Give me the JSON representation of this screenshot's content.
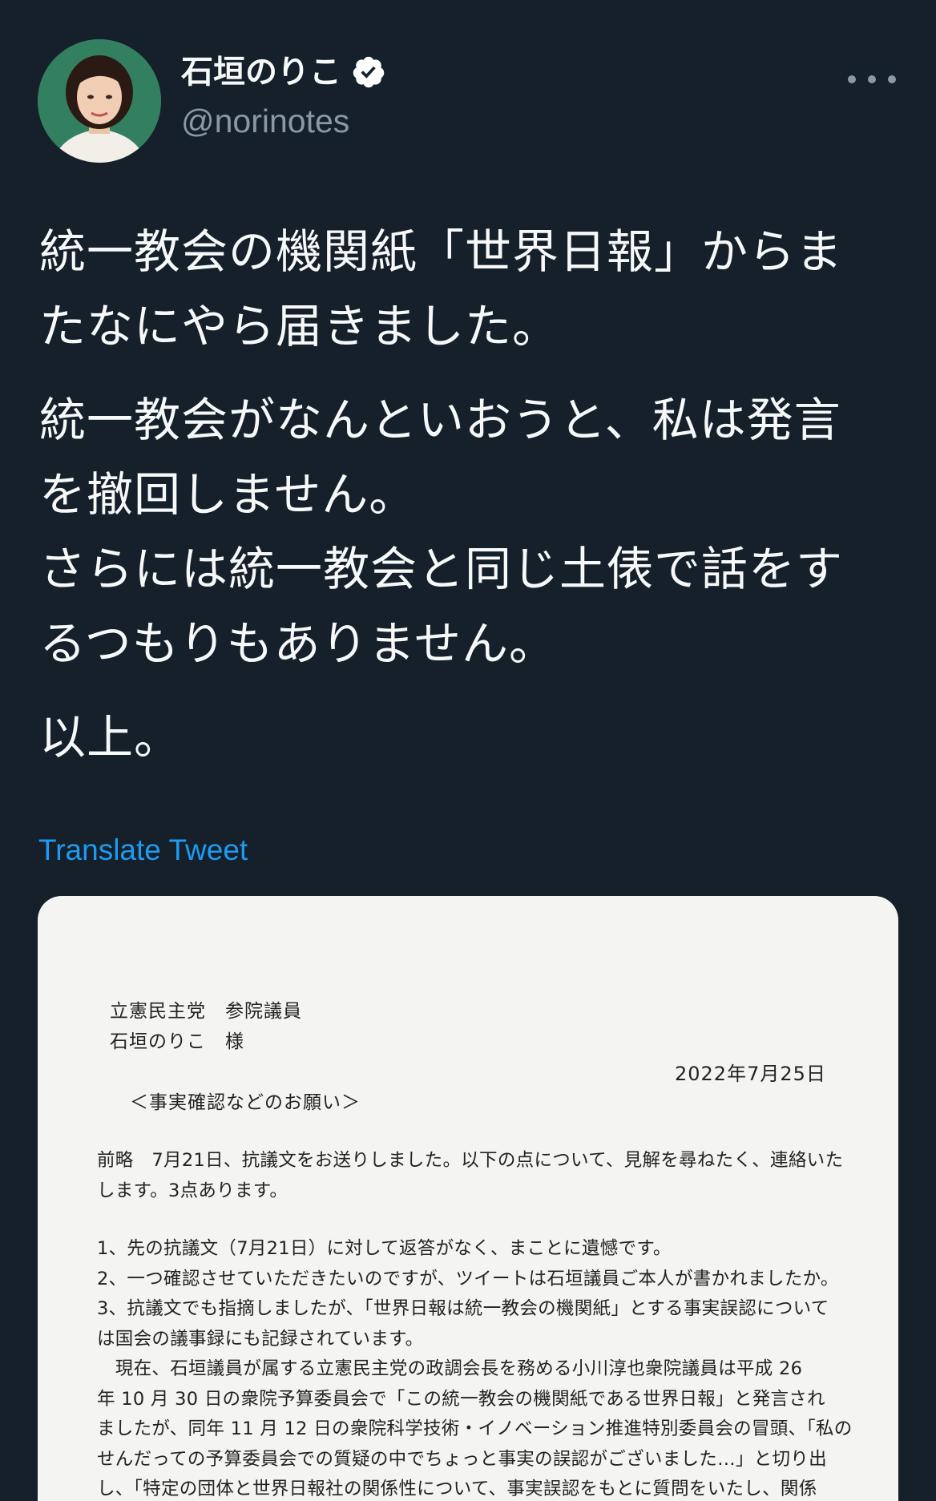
{
  "author": {
    "display_name": "石垣のりこ",
    "handle": "@norinotes",
    "verified": true,
    "avatar_icon": "profile-photo"
  },
  "more_icon": "more-horizontal-icon",
  "tweet": {
    "paragraphs": [
      [
        "統一教会の機関紙「世界日報」からま",
        "たなにやら届きました。"
      ],
      [
        "統一教会がなんといおうと、私は発言",
        "を撤回しません。",
        "さらには統一教会と同じ土俵で話をす",
        "るつもりもありません。"
      ],
      [
        "以上。"
      ]
    ],
    "translate_label": "Translate Tweet"
  },
  "letter": {
    "addressee_line1": "立憲民主党　参院議員",
    "addressee_line2": "石垣のりこ　様",
    "date": "2022年7月25日",
    "subject": "＜事実確認などのお願い＞",
    "intro": [
      "前略　7月21日、抗議文をお送りしました。以下の点について、見解を尋ねたく、連絡いた",
      "します。3点あります。"
    ],
    "points": [
      "1、先の抗議文（7月21日）に対して返答がなく、まことに遺憾です。",
      "2、一つ確認させていただきたいのですが、ツイートは石垣議員ご本人が書かれましたか。",
      "3、抗議文でも指摘しましたが、「世界日報は統一教会の機関紙」とする事実誤認について",
      "は国会の議事録にも記録されています。",
      "　現在、石垣議員が属する立憲民主党の政調会長を務める小川淳也衆院議員は平成 26",
      "年 10 月 30 日の衆院予算委員会で「この統一教会の機関紙である世界日報」と発言され",
      "ましたが、同年 11 月 12 日の衆院科学技術・イノベーション推進特別委員会の冒頭、「私の",
      "せんだっての予算委員会での質疑の中でちょっと事実の誤認がございました…」と切り出",
      "し、「特定の団体と世界日報社の関係性について、事実誤認をもとに質問をいたし、関係"
    ]
  },
  "colors": {
    "background": "#15202b",
    "text_primary": "#f7f9f9",
    "text_secondary": "#8b98a5",
    "link": "#1d9bf0",
    "verified_badge": "#ffffff"
  }
}
